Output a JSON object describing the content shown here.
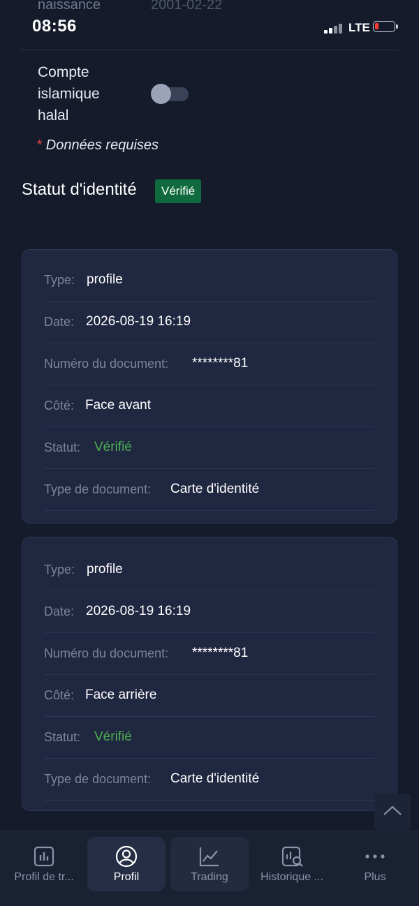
{
  "prev_field": {
    "label": "naissance",
    "value": "2001-02-22"
  },
  "status_bar": {
    "time": "08:56",
    "network": "LTE"
  },
  "islamic_account": {
    "label": "Compte\nislamique\nhalal",
    "enabled": false
  },
  "required_note": {
    "star": "*",
    "text": "Données requises"
  },
  "identity": {
    "title": "Statut d'identité",
    "badge": "Vérifié"
  },
  "documents": [
    {
      "rows": [
        {
          "key": "Type:",
          "value": "profile"
        },
        {
          "key": "Date:",
          "value": "2026-08-19 16:19"
        },
        {
          "key": "Numéro du document:",
          "value": "********81"
        },
        {
          "key": "Côté:",
          "value": "Face avant"
        },
        {
          "key": "Statut:",
          "value": "Vérifié"
        },
        {
          "key": "Type de document:",
          "value": "Carte d'identité"
        }
      ]
    },
    {
      "rows": [
        {
          "key": "Type:",
          "value": "profile"
        },
        {
          "key": "Date:",
          "value": "2026-08-19 16:19"
        },
        {
          "key": "Numéro du document:",
          "value": "********81"
        },
        {
          "key": "Côté:",
          "value": "Face arrière"
        },
        {
          "key": "Statut:",
          "value": "Vérifié"
        },
        {
          "key": "Type de document:",
          "value": "Carte d'identité"
        }
      ]
    }
  ],
  "nav": [
    {
      "label": "Profil de tr...",
      "icon": "bar-chart-icon"
    },
    {
      "label": "Profil",
      "icon": "user-circle-icon",
      "active": true
    },
    {
      "label": "Trading",
      "icon": "line-chart-icon"
    },
    {
      "label": "Historique ...",
      "icon": "history-search-icon"
    },
    {
      "label": "Plus",
      "icon": "more-dots-icon"
    }
  ],
  "colors": {
    "background": "#151b2b",
    "card": "#202740",
    "verified": "#4caf50",
    "badge": "#0f6b3d",
    "required_star": "#e0443c"
  }
}
